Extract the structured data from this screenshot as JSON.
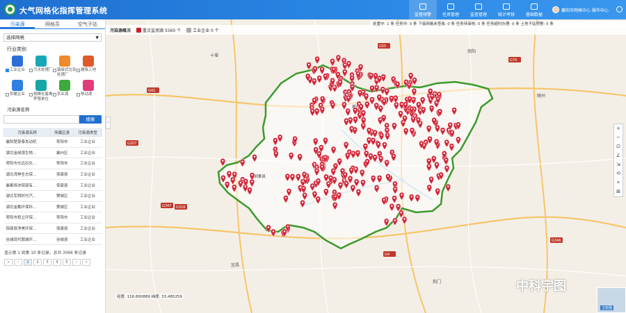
{
  "header": {
    "title": "大气网格化指挥管理系统",
    "nav": [
      {
        "label": "监督预警",
        "active": true
      },
      {
        "label": "任务管理",
        "active": false
      },
      {
        "label": "监查管理",
        "active": false
      },
      {
        "label": "统计考核",
        "active": false
      },
      {
        "label": "基础数据",
        "active": false
      }
    ],
    "user": "襄阳市网格中心 操作中心"
  },
  "left": {
    "tabs": [
      "污染源",
      "网格员",
      "空气子站"
    ],
    "select_value": "选择网格",
    "section_title": "行业类别",
    "categories": [
      {
        "label": "工业企业",
        "checked": true,
        "color": "#2b6fd6"
      },
      {
        "label": "污水处理厂",
        "checked": false,
        "color": "#19a7b8"
      },
      {
        "label": "镇级式垃圾处理厂",
        "checked": false,
        "color": "#f08a2a"
      },
      {
        "label": "建筑工地",
        "checked": false,
        "color": "#e0592a"
      },
      {
        "label": "供暖企业",
        "checked": false,
        "color": "#2e7fe0"
      },
      {
        "label": "规模化畜禽养殖单位",
        "checked": false,
        "color": "#16a6a6"
      },
      {
        "label": "农业源",
        "checked": false,
        "color": "#3caa3c"
      },
      {
        "label": "移动源",
        "checked": false,
        "color": "#e03c7a"
      }
    ],
    "search_label": "污染源名称",
    "search_button": "搜索",
    "table": {
      "headers": [
        "污染源名称",
        "所属区县",
        "污染源类型"
      ],
      "rows": [
        [
          "襄阳楚豪泰发动机",
          "枣阳市",
          "工业企业"
        ],
        [
          "湖北金绿源生物…",
          "襄州区",
          "工业企业"
        ],
        [
          "枣阳市光远石化…",
          "枣阳市",
          "工业企业"
        ],
        [
          "湖北湾神圣志保…",
          "保康县",
          "工业企业"
        ],
        [
          "襄都扬浓保康有…",
          "保康县",
          "工业企业"
        ],
        [
          "湖北军翔时代汽…",
          "樊城区",
          "工业企业"
        ],
        [
          "湖北金戴环保科…",
          "樊城区",
          "工业企业"
        ],
        [
          "枣阳市和立环保…",
          "枣阳市",
          "工业企业"
        ],
        [
          "保康县净美环保…",
          "保康县",
          "工业企业"
        ],
        [
          "谷城现代葡城环…",
          "谷城县",
          "工业企业"
        ]
      ]
    },
    "pager_info": "显示第 1 到第 10 条记录，总共 3066 条记录",
    "pager": [
      "«",
      "‹",
      "1",
      "2",
      "3",
      "4",
      "5",
      "›",
      "»"
    ]
  },
  "map": {
    "toolbar_title": "污染源概况",
    "legend": [
      {
        "label": "重点监测源 5560 个",
        "color": "#c9202f"
      },
      {
        "label": "工业企业 0 个",
        "color": "#aaaaaa"
      }
    ],
    "status_strip": "处置中: 1 条  任务中: 0 条  下级网格未签收: 0 条  任务待审核: 0 条  任务超时办理: 0 条  土地子站预警: 0 条",
    "coords": "经度: 116.800889 纬度: 33.485259",
    "watermark": "中科宇图",
    "minimap_label": "卫星图",
    "tools": [
      "+",
      "−",
      "⊡",
      "∠",
      "⇲",
      "⟲",
      "⌗",
      "⊠"
    ],
    "cities": [
      "十堰",
      "襄阳",
      "随州",
      "南阳",
      "保康县",
      "荆门",
      "宜昌"
    ],
    "highways": [
      "G70",
      "G42",
      "G55",
      "G207",
      "G316",
      "G346",
      "G347",
      "G4"
    ],
    "marker_color": "#d3273a",
    "boundary_color": "#3a9a2a"
  }
}
